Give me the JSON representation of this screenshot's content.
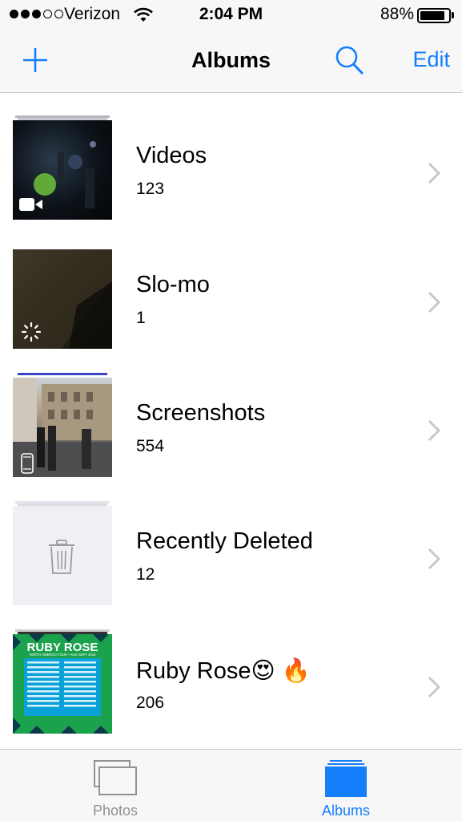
{
  "status_bar": {
    "carrier": "Verizon",
    "time": "2:04 PM",
    "battery_percent": "88%",
    "battery_level": 0.88,
    "signal_bars_filled": 3,
    "signal_bars_total": 5
  },
  "nav_bar": {
    "title": "Albums",
    "edit_label": "Edit",
    "add_icon": "plus-icon",
    "search_icon": "search-icon"
  },
  "albums": [
    {
      "name": "Videos",
      "count": "123",
      "badge_icon": "video-camera-icon"
    },
    {
      "name": "Slo-mo",
      "count": "1",
      "badge_icon": "slo-mo-icon"
    },
    {
      "name": "Screenshots",
      "count": "554",
      "badge_icon": "iphone-icon"
    },
    {
      "name": "Recently Deleted",
      "count": "12",
      "badge_icon": "trash-icon"
    },
    {
      "name": "Ruby Rose😍 🔥",
      "count": "206",
      "badge_icon": ""
    }
  ],
  "ruby_thumb": {
    "title": "RUBY ROSE",
    "subtitle": "NORTH AMERICA TOUR • AUG-SEPT 2015"
  },
  "tab_bar": {
    "tabs": [
      {
        "label": "Photos",
        "icon": "photos-stack-icon",
        "selected": false
      },
      {
        "label": "Albums",
        "icon": "albums-icon",
        "selected": true
      }
    ]
  },
  "colors": {
    "accent": "#147efb",
    "inactive_tab": "#929292",
    "bar_background": "#f7f7f7"
  }
}
